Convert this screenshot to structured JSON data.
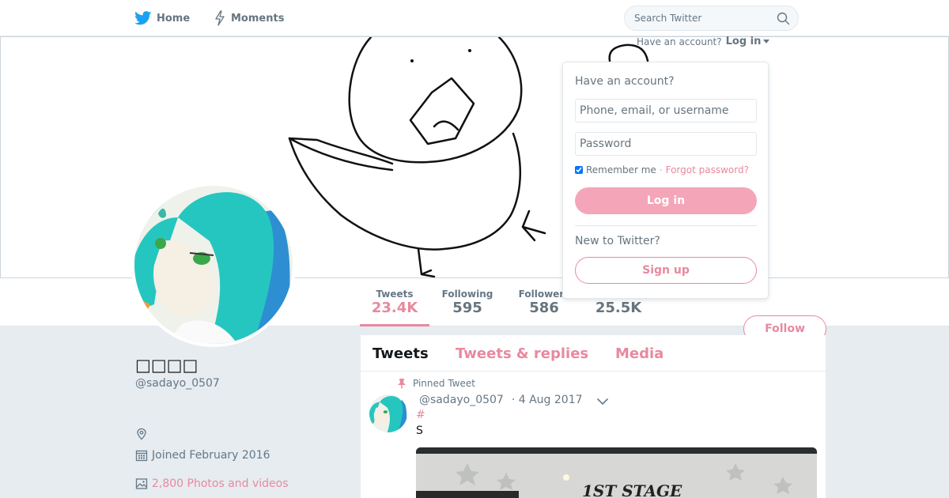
{
  "nav": {
    "home_label": "Home",
    "moments_label": "Moments",
    "search_placeholder": "Search Twitter"
  },
  "login": {
    "prompt": "Have an account?",
    "link": "Log in",
    "panel_title": "Have an account?",
    "username_placeholder": "Phone, email, or username",
    "password_placeholder": "Password",
    "remember_label": "Remember me",
    "separator": "·",
    "forgot_label": "Forgot password?",
    "login_button": "Log in",
    "new_prompt": "New to Twitter?",
    "signup_button": "Sign up"
  },
  "profile": {
    "display_name": "□□□□",
    "screen_name": "@sadayo_0507",
    "joined": "Joined February 2016",
    "photos": "2,800 Photos and videos",
    "follow_button": "Follow"
  },
  "stats": {
    "tweets": {
      "label": "Tweets",
      "value": "23.4K"
    },
    "following": {
      "label": "Following",
      "value": "595"
    },
    "followers": {
      "label": "Followers",
      "value": "586"
    },
    "likes": {
      "label": "",
      "value": "25.5K"
    }
  },
  "timeline": {
    "tabs": [
      "Tweets",
      "Tweets & replies",
      "Media"
    ],
    "pinned_label": "Pinned Tweet",
    "tweet": {
      "author": "@sadayo_0507",
      "date": "· 4 Aug 2017",
      "hashtag": "#",
      "text": "S",
      "media_text": "1ST STAGE"
    }
  },
  "colors": {
    "accent": "#e8899f",
    "accent_light": "#f4a6b8",
    "twitter_blue": "#1da1f2",
    "background": "#e6ecf0"
  }
}
